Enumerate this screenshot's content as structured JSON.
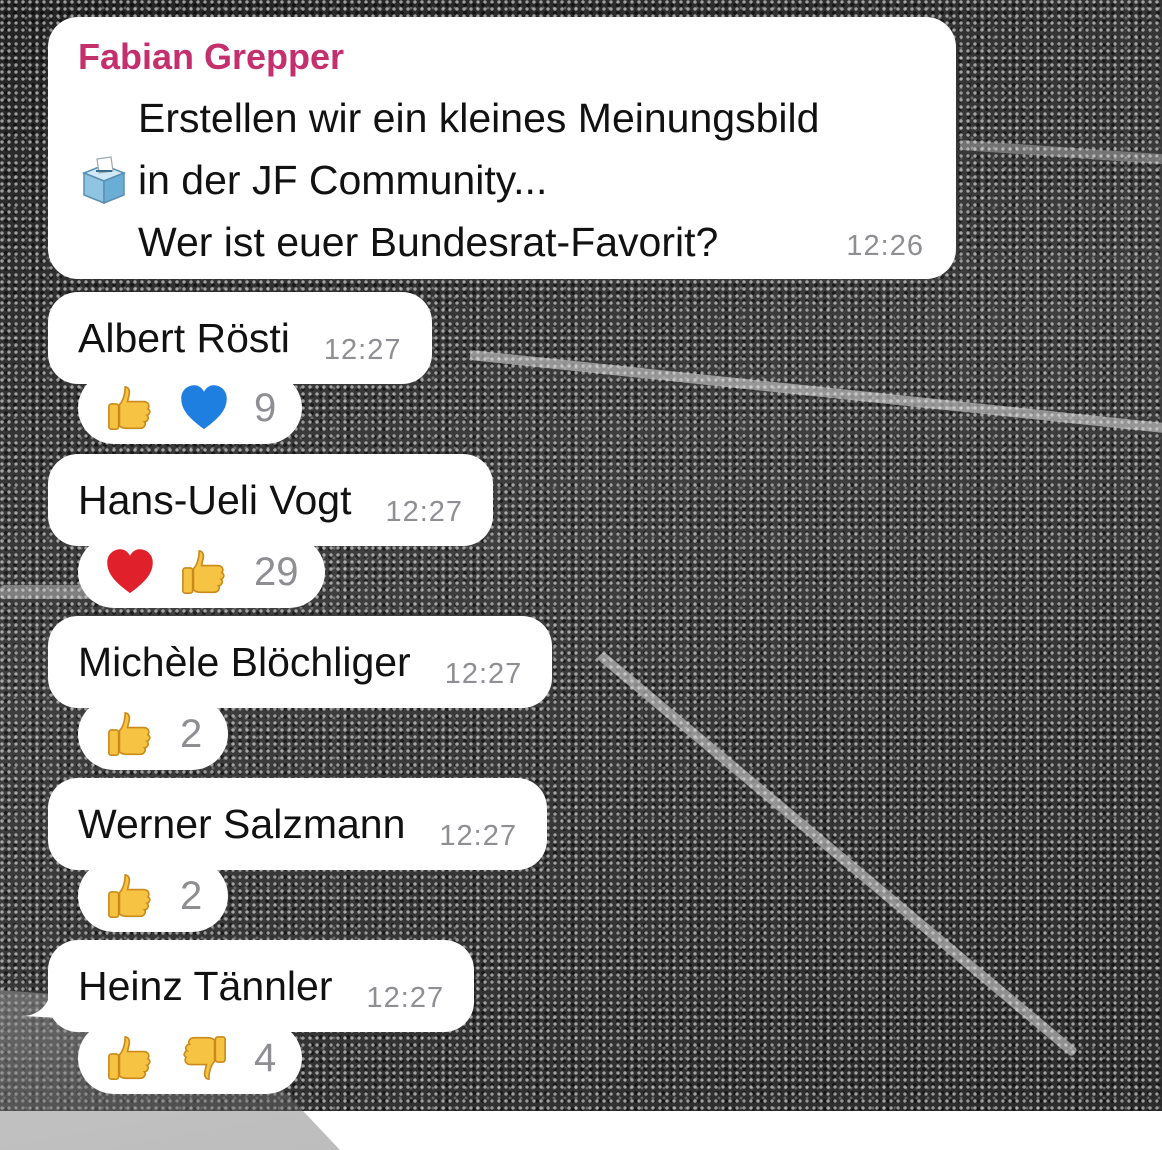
{
  "post": {
    "sender": "Fabian Grepper",
    "text": "Erstellen wir ein kleines Meinungsbild\nin der JF Community...\nWer ist euer Bundesrat-Favorit?",
    "time": "12:26",
    "icon": "ballot-box-icon"
  },
  "replies": [
    {
      "name": "Albert Rösti",
      "time": "12:27",
      "reactions": [
        "thumbs-up-icon",
        "blue-heart-icon"
      ],
      "count": "9"
    },
    {
      "name": "Hans-Ueli Vogt",
      "time": "12:27",
      "reactions": [
        "red-heart-icon",
        "thumbs-up-icon"
      ],
      "count": "29"
    },
    {
      "name": "Michèle Blöchliger",
      "time": "12:27",
      "reactions": [
        "thumbs-up-icon"
      ],
      "count": "2"
    },
    {
      "name": "Werner Salzmann",
      "time": "12:27",
      "reactions": [
        "thumbs-up-icon"
      ],
      "count": "2"
    },
    {
      "name": "Heinz Tännler",
      "time": "12:27",
      "reactions": [
        "thumbs-up-icon",
        "thumbs-down-icon"
      ],
      "count": "4"
    }
  ],
  "colors": {
    "sender_name": "#c4306d",
    "bubble": "#ffffff",
    "timestamp": "#8e8e93",
    "reaction_count": "#8e8e93"
  }
}
